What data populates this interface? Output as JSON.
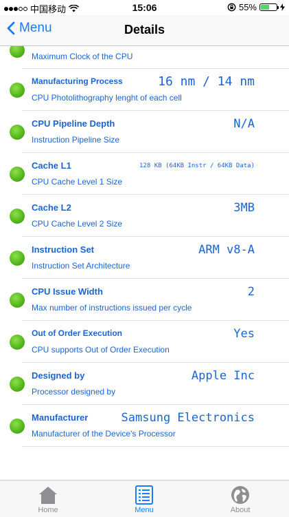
{
  "status_bar": {
    "carrier": "中国移动",
    "time": "15:06",
    "battery": "55%",
    "battery_level": 0.55
  },
  "nav": {
    "back_label": "Menu",
    "title": "Details"
  },
  "rows": [
    {
      "title": "",
      "subtitle": "Maximum Clock of the CPU",
      "value": ""
    },
    {
      "title": "Manufacturing Process",
      "subtitle": "CPU Photolithography lenght of each cell",
      "value": "16 nm / 14 nm"
    },
    {
      "title": "CPU Pipeline Depth",
      "subtitle": "Instruction Pipeline Size",
      "value": "N/A"
    },
    {
      "title": "Cache L1",
      "subtitle": "CPU Cache Level 1 Size",
      "value": "128 KB (64KB Instr / 64KB Data)"
    },
    {
      "title": "Cache L2",
      "subtitle": "CPU Cache Level 2 Size",
      "value": "3MB"
    },
    {
      "title": "Instruction Set",
      "subtitle": "Instruction Set Architecture",
      "value": "ARM v8-A"
    },
    {
      "title": "CPU Issue Width",
      "subtitle": "Max number of instructions issued per cycle",
      "value": "2"
    },
    {
      "title": "Out of Order Execution",
      "subtitle": "CPU supports Out of Order Execution",
      "value": "Yes"
    },
    {
      "title": "Designed by",
      "subtitle": "Processor designed by",
      "value": "Apple Inc"
    },
    {
      "title": "Manufacturer",
      "subtitle": "Manufacturer of the Device's Processor",
      "value": "Samsung Electronics"
    }
  ],
  "tabbar": [
    {
      "label": "Home",
      "icon": "home-icon",
      "active": false
    },
    {
      "label": "Menu",
      "icon": "menu-list-icon",
      "active": true
    },
    {
      "label": "About",
      "icon": "about-icon",
      "active": false
    }
  ],
  "colors": {
    "accent": "#1a7cf5",
    "text_blue": "#1a64d6",
    "bullet_green": "#56b81d",
    "inactive": "#8e8e93"
  }
}
